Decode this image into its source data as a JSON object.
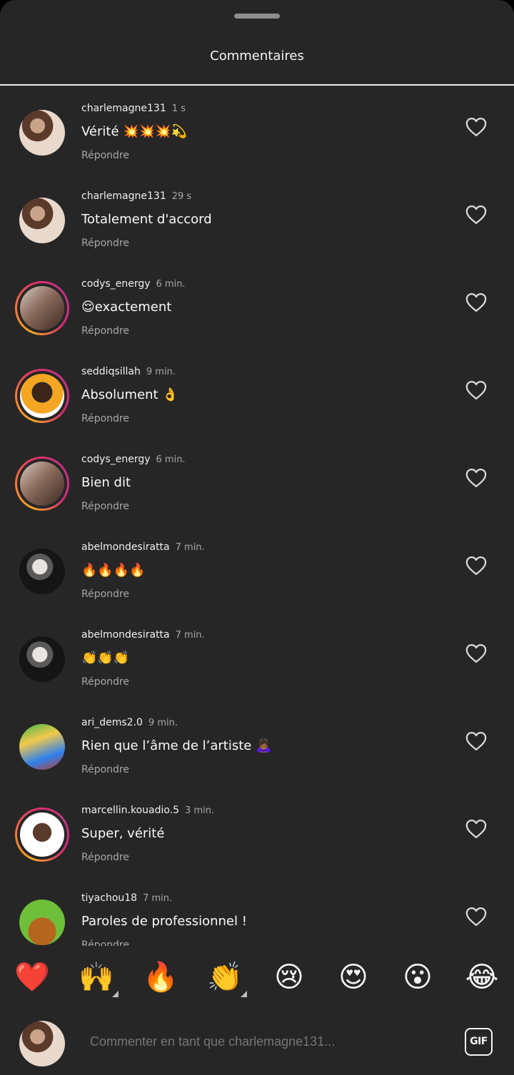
{
  "sheet": {
    "title": "Commentaires"
  },
  "comments": [
    {
      "user": "charlemagne131",
      "time": "1 s",
      "text": "Vérité 💥💥💥💫",
      "reply": "Répondre",
      "story_ring": false,
      "avatar": "av-photo1"
    },
    {
      "user": "charlemagne131",
      "time": "29 s",
      "text": "Totalement d'accord",
      "reply": "Répondre",
      "story_ring": false,
      "avatar": "av-photo1"
    },
    {
      "user": "codys_energy",
      "time": "6 min.",
      "text": "😌exactement",
      "reply": "Répondre",
      "story_ring": true,
      "avatar": "av-photo2"
    },
    {
      "user": "seddiqsillah",
      "time": "9 min.",
      "text": "Absolument 👌",
      "reply": "Répondre",
      "story_ring": true,
      "avatar": "av-photo3"
    },
    {
      "user": "codys_energy",
      "time": "6 min.",
      "text": "Bien dit",
      "reply": "Répondre",
      "story_ring": true,
      "avatar": "av-photo2"
    },
    {
      "user": "abelmondesiratta",
      "time": "7 min.",
      "text": "🔥🔥🔥🔥",
      "reply": "Répondre",
      "story_ring": false,
      "avatar": "av-photo4"
    },
    {
      "user": "abelmondesiratta",
      "time": "7 min.",
      "text": "👏👏👏",
      "reply": "Répondre",
      "story_ring": false,
      "avatar": "av-photo4"
    },
    {
      "user": "ari_dems2.0",
      "time": "9 min.",
      "text": "Rien que l’âme de l’artiste 🙇🏾‍♀️",
      "reply": "Répondre",
      "story_ring": false,
      "avatar": "av-photo5"
    },
    {
      "user": "marcellin.kouadio.5",
      "time": "3 min.",
      "text": "Super, vérité",
      "reply": "Répondre",
      "story_ring": true,
      "avatar": "av-photo6"
    },
    {
      "user": "tiyachou18",
      "time": "7 min.",
      "text": "Paroles de professionnel !",
      "reply": "Répondre",
      "story_ring": false,
      "avatar": "av-photo7"
    }
  ],
  "icons": {
    "like": "heart-outline-icon",
    "gif": "gif-icon"
  },
  "reactions": [
    {
      "emoji": "❤️",
      "name": "heart",
      "has_more": false
    },
    {
      "emoji": "🙌",
      "name": "raising-hands",
      "has_more": true
    },
    {
      "emoji": "🔥",
      "name": "fire",
      "has_more": false
    },
    {
      "emoji": "👏",
      "name": "clapping-hands",
      "has_more": true
    },
    {
      "emoji": "😢",
      "name": "crying-face",
      "has_more": false
    },
    {
      "emoji": "😍",
      "name": "heart-eyes",
      "has_more": false
    },
    {
      "emoji": "😮",
      "name": "surprised-face",
      "has_more": false
    },
    {
      "emoji": "😂",
      "name": "tears-of-joy",
      "has_more": false
    }
  ],
  "composer": {
    "placeholder": "Commenter en tant que charlemagne131...",
    "gif_label": "GIF",
    "avatar": "av-photo1"
  },
  "colors": {
    "sheet_background": "#262626",
    "primary_text": "#f5f5f5",
    "secondary_text": "#a8a8a8"
  }
}
